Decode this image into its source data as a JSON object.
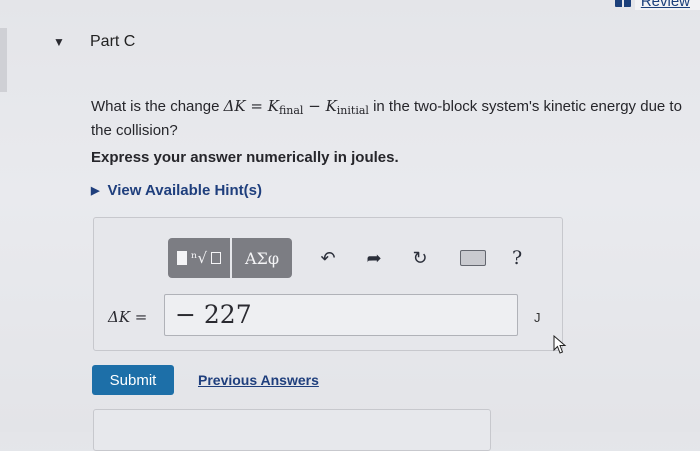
{
  "header": {
    "review_label": "Review",
    "review_icon": "book-icon"
  },
  "part": {
    "title": "Part C",
    "toggle_icon": "triangle-down-icon"
  },
  "question": {
    "text_before": "What is the change ",
    "delta_k": "ΔK",
    "equals": " = ",
    "k_final_symbol": "K",
    "k_final_sub": "final",
    "minus": " − ",
    "k_initial_symbol": "K",
    "k_initial_sub": "initial",
    "text_after": " in the two-block system's kinetic energy due to the collision?"
  },
  "instruction": "Express your answer numerically in joules.",
  "hint": {
    "label": "View Available Hint(s)",
    "icon": "triangle-right-icon"
  },
  "toolbar": {
    "templates_icon": "templates-icon",
    "greek_label": "ΑΣφ",
    "undo_icon": "undo-icon",
    "redo_icon": "redo-icon",
    "reset_icon": "reset-icon",
    "keyboard_icon": "keyboard-icon",
    "help_label": "?"
  },
  "answer": {
    "label": "ΔK =",
    "value": "− 227",
    "unit": "J"
  },
  "actions": {
    "submit_label": "Submit",
    "previous_answers_label": "Previous Answers"
  }
}
